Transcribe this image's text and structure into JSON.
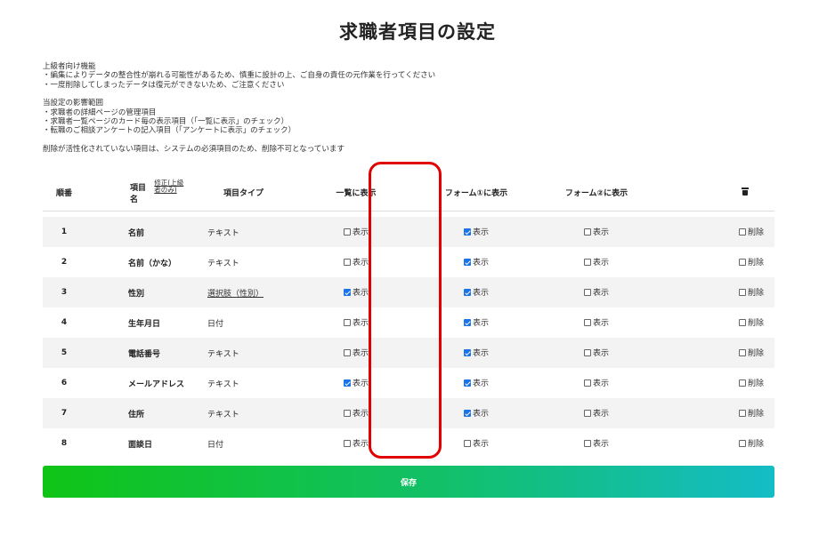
{
  "page": {
    "title": "求職者項目の設定"
  },
  "notes": {
    "block1": [
      "上級者向け機能",
      "・編集によりデータの整合性が崩れる可能性があるため、慎重に設計の上、ご自身の責任の元作業を行ってください",
      "・一度削除してしまったデータは復元ができないため、ご注意ください"
    ],
    "block2": [
      "当設定の影響範囲",
      "・求職者の詳細ページの管理項目",
      "・求職者一覧ページのカード毎の表示項目（「一覧に表示」のチェック）",
      "・転職のご相談アンケートの記入項目（「アンケートに表示」のチェック）"
    ],
    "block3": [
      "削除が活性化されていない項目は、システムの必須項目のため、削除不可となっています"
    ]
  },
  "table": {
    "headers": {
      "no": "順番",
      "name": "項目名",
      "name_edit": "修正(上級者のみ)",
      "type": "項目タイプ",
      "list": "一覧に表示",
      "form1": "フォーム①に表示",
      "form2": "フォーム②に表示",
      "delete_icon": "trash-icon"
    },
    "show_label": "表示",
    "delete_label": "削除",
    "rows": [
      {
        "no": "1",
        "name": "名前",
        "type": "テキスト",
        "type_link": false,
        "list": false,
        "form1": true,
        "form2": false,
        "del": false
      },
      {
        "no": "2",
        "name": "名前（かな）",
        "type": "テキスト",
        "type_link": false,
        "list": false,
        "form1": true,
        "form2": false,
        "del": false
      },
      {
        "no": "3",
        "name": "性別",
        "type": "選択肢（性別）",
        "type_link": true,
        "list": true,
        "form1": true,
        "form2": false,
        "del": false
      },
      {
        "no": "4",
        "name": "生年月日",
        "type": "日付",
        "type_link": false,
        "list": false,
        "form1": true,
        "form2": false,
        "del": false
      },
      {
        "no": "5",
        "name": "電話番号",
        "type": "テキスト",
        "type_link": false,
        "list": false,
        "form1": true,
        "form2": false,
        "del": false
      },
      {
        "no": "6",
        "name": "メールアドレス",
        "type": "テキスト",
        "type_link": false,
        "list": true,
        "form1": true,
        "form2": false,
        "del": false
      },
      {
        "no": "7",
        "name": "住所",
        "type": "テキスト",
        "type_link": false,
        "list": false,
        "form1": true,
        "form2": false,
        "del": false
      },
      {
        "no": "8",
        "name": "面談日",
        "type": "日付",
        "type_link": false,
        "list": false,
        "form1": false,
        "form2": false,
        "del": false
      }
    ]
  },
  "actions": {
    "save_label": "保存"
  },
  "colors": {
    "highlight": "#e00000",
    "checkbox_checked": "#1a73e8",
    "save_gradient_start": "#10c416",
    "save_gradient_end": "#14bcc6"
  }
}
